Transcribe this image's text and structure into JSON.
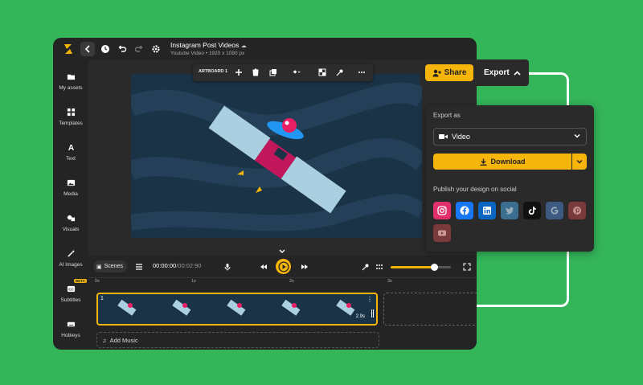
{
  "app": {
    "title": "Instagram Post Videos",
    "subtitle": "Youtube Video • 1920 x 1080 px",
    "artboard_label": "ARTBOARD 1"
  },
  "sidebar": {
    "items": [
      {
        "label": "My assets",
        "icon": "folder-icon"
      },
      {
        "label": "Templates",
        "icon": "grid-icon"
      },
      {
        "label": "Text",
        "icon": "text-icon"
      },
      {
        "label": "Media",
        "icon": "image-icon"
      },
      {
        "label": "Visuals",
        "icon": "shapes-icon"
      },
      {
        "label": "AI Images",
        "icon": "magic-wand-icon"
      },
      {
        "label": "Subtitles",
        "icon": "cc-icon",
        "badge": "BETA"
      },
      {
        "label": "Hotkeys",
        "icon": "keyboard-icon"
      }
    ]
  },
  "controls": {
    "scenes_label": "Scenes",
    "current_time": "00:00:00",
    "total_time": "/00:02:90",
    "volume_level": 0.72
  },
  "timeline": {
    "ticks": [
      "0s",
      "1s",
      "2s",
      "3s"
    ],
    "clip_number": "1",
    "clip_duration": "2.9s",
    "add_music": "Add Music"
  },
  "share": {
    "share_label": "Share",
    "export_label": "Export"
  },
  "export_panel": {
    "export_as": "Export as",
    "format": "Video",
    "download": "Download",
    "publish_label": "Publish your design on social",
    "socials": [
      {
        "name": "instagram-icon",
        "color": "#e1306c"
      },
      {
        "name": "facebook-icon",
        "color": "#1877f2"
      },
      {
        "name": "linkedin-icon",
        "color": "#0a66c2"
      },
      {
        "name": "twitter-icon",
        "color": "#3b6e8f"
      },
      {
        "name": "tiktok-icon",
        "color": "#111111"
      },
      {
        "name": "google-icon",
        "color": "#3d5a80"
      },
      {
        "name": "pinterest-icon",
        "color": "#7a3a3a"
      },
      {
        "name": "youtube-icon",
        "color": "#7a3a3a"
      }
    ]
  },
  "colors": {
    "accent": "#f5b50a",
    "background": "#34b55a",
    "panel": "#2a2a2a",
    "artboard": "#1b3346"
  }
}
